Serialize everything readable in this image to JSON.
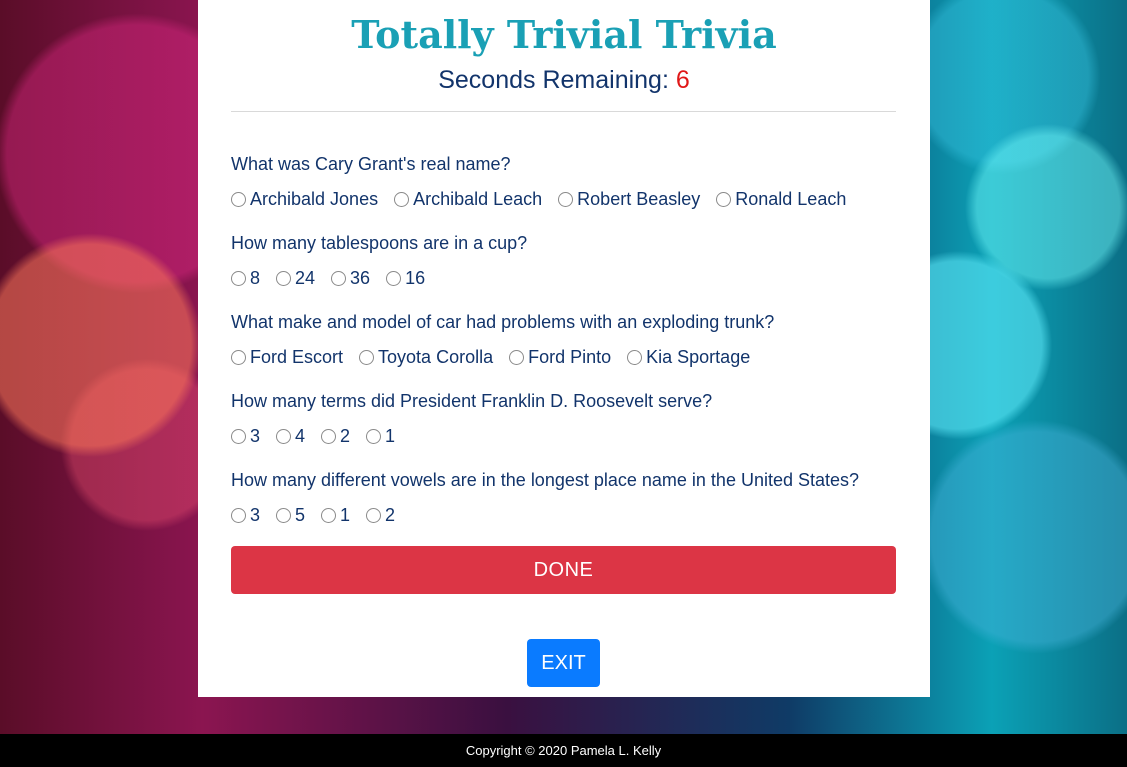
{
  "app": {
    "title": "Totally Trivial Trivia",
    "seconds_label": "Seconds Remaining: ",
    "seconds_value": "6"
  },
  "questions": [
    {
      "text": "What was Cary Grant's real name?",
      "options": [
        "Archibald Jones",
        "Archibald Leach",
        "Robert Beasley",
        "Ronald Leach"
      ]
    },
    {
      "text": "How many tablespoons are in a cup?",
      "options": [
        "8",
        "24",
        "36",
        "16"
      ]
    },
    {
      "text": "What make and model of car had problems with an exploding trunk?",
      "options": [
        "Ford Escort",
        "Toyota Corolla",
        "Ford Pinto",
        "Kia Sportage"
      ]
    },
    {
      "text": "How many terms did President Franklin D. Roosevelt serve?",
      "options": [
        "3",
        "4",
        "2",
        "1"
      ]
    },
    {
      "text": "How many different vowels are in the longest place name in the United States?",
      "options": [
        "3",
        "5",
        "1",
        "2"
      ]
    }
  ],
  "buttons": {
    "done_label": "DONE",
    "exit_label": "EXIT"
  },
  "footer": {
    "copyright": "Copyright © 2020 Pamela L. Kelly"
  },
  "colors": {
    "title": "#1aa0b5",
    "text": "#12346b",
    "timer": "#e01818",
    "done_button": "#dc3545",
    "exit_button": "#0a7bff",
    "footer_bg": "#000000"
  }
}
